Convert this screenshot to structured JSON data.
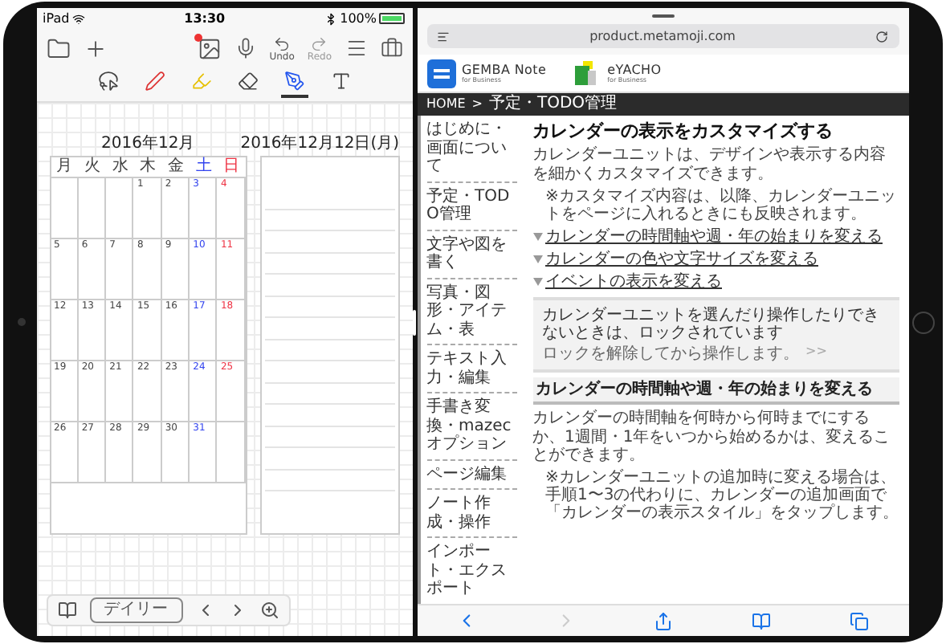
{
  "status_bar": {
    "carrier": "iPad",
    "time": "13:30",
    "battery": "100%"
  },
  "note_app": {
    "undo": {
      "label": "Undo",
      "disabled": false
    },
    "redo": {
      "label": "Redo",
      "disabled": true
    },
    "tools": [
      {
        "kind": "lasso",
        "selected": false
      },
      {
        "kind": "pen",
        "selected": false
      },
      {
        "kind": "highlighter",
        "selected": false
      },
      {
        "kind": "eraser",
        "selected": false
      },
      {
        "kind": "color",
        "selected": true
      },
      {
        "kind": "text",
        "selected": false
      }
    ],
    "month_calendar": {
      "title": "2016年12月",
      "weekdays": [
        {
          "label": "月",
          "color": "#444444"
        },
        {
          "label": "火",
          "color": "#444444"
        },
        {
          "label": "水",
          "color": "#444444"
        },
        {
          "label": "木",
          "color": "#444444"
        },
        {
          "label": "金",
          "color": "#444444"
        },
        {
          "label": "土",
          "color": "#3344ee"
        },
        {
          "label": "日",
          "color": "#ee3344"
        }
      ],
      "weeks": [
        {
          "kind": "first",
          "days": [
            "1",
            "2",
            "3",
            "4"
          ]
        },
        {
          "kind": "full",
          "days": [
            "5",
            "6",
            "7",
            "8",
            "9",
            "10",
            "11"
          ]
        },
        {
          "kind": "full",
          "days": [
            "12",
            "13",
            "14",
            "15",
            "16",
            "17",
            "18"
          ]
        },
        {
          "kind": "full",
          "days": [
            "19",
            "20",
            "21",
            "22",
            "23",
            "24",
            "25"
          ]
        },
        {
          "kind": "last",
          "days": [
            "26",
            "27",
            "28",
            "29",
            "30",
            "31"
          ]
        }
      ]
    },
    "daily": {
      "title": "2016年12月12日(月)"
    },
    "bottom_bar": {
      "view_button": "デイリー"
    }
  },
  "browser": {
    "url": "product.metamoji.com",
    "logos": [
      {
        "kind": "gemba",
        "name": "GEMBA Note",
        "sub": "for Business"
      },
      {
        "kind": "eyacho",
        "name": "eYACHO",
        "sub": "for Business"
      }
    ],
    "breadcrumb": {
      "home": "HOME",
      "separator": ">",
      "current": "予定・TODO管理"
    },
    "sidebar": [
      "はじめに・画面について",
      "予定・TODO管理",
      "文字や図を書く",
      "写真・図形・アイテム・表",
      "テキスト入力・編集",
      "手書き変換・mazecオプション",
      "ページ編集",
      "ノート作成・操作",
      "インポート・エクスポート"
    ],
    "article": {
      "title": "カレンダーの表示をカスタマイズする",
      "intro": "カレンダーユニットは、デザインや表示する内容を細かくカスタマイズできます。",
      "note": "※カスタマイズ内容は、以降、カレンダーユニットをページに入れるときにも反映されます。",
      "links": [
        "カレンダーの時間軸や週・年の始まりを変える",
        "カレンダーの色や文字サイズを変える",
        "イベントの表示を変える"
      ],
      "callout": {
        "text": "カレンダーユニットを選んだり操作したりできないときは、ロックされています",
        "link": "ロックを解除してから操作します。",
        "arrow": ">>"
      },
      "section": {
        "heading": "カレンダーの時間軸や週・年の始まりを変える",
        "body": "カレンダーの時間軸を何時から何時までにするか、1週間・1年をいつから始めるかは、変えることができます。",
        "note": "※カレンダーユニットの追加時に変える場合は、手順1〜3の代わりに、カレンダーの追加画面で「カレンダーの表示スタイル」をタップします。"
      }
    },
    "forward_disabled": true
  }
}
